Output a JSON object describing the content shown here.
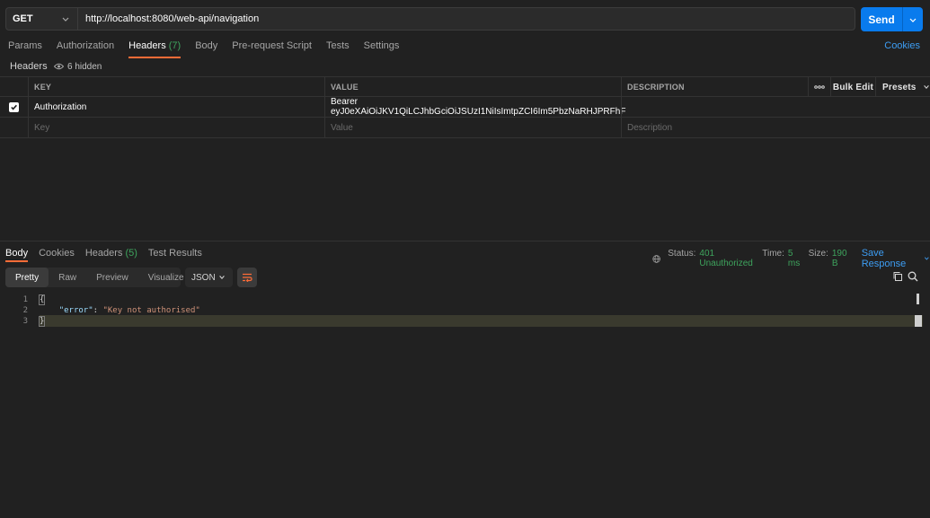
{
  "request": {
    "method": "GET",
    "url": "http://localhost:8080/web-api/navigation",
    "send_label": "Send"
  },
  "request_tabs": [
    {
      "label": "Params",
      "count": ""
    },
    {
      "label": "Authorization",
      "count": ""
    },
    {
      "label": "Headers",
      "count": "(7)"
    },
    {
      "label": "Body",
      "count": ""
    },
    {
      "label": "Pre-request Script",
      "count": ""
    },
    {
      "label": "Tests",
      "count": ""
    },
    {
      "label": "Settings",
      "count": ""
    }
  ],
  "cookies_label": "Cookies",
  "headers_section": {
    "title": "Headers",
    "hidden_label": "6 hidden",
    "columns": {
      "key": "KEY",
      "value": "VALUE",
      "description": "DESCRIPTION",
      "bulk_edit": "Bulk Edit",
      "presets": "Presets"
    },
    "rows": [
      {
        "key": "Authorization",
        "value": "Bearer eyJ0eXAiOiJKV1QiLCJhbGciOiJSUzI1NiIsImtpZCI6Im5PbzNaRHJPRFhF",
        "description": "",
        "checked": true
      }
    ],
    "placeholders": {
      "key": "Key",
      "value": "Value",
      "description": "Description"
    }
  },
  "response_tabs": [
    {
      "label": "Body",
      "count": ""
    },
    {
      "label": "Cookies",
      "count": ""
    },
    {
      "label": "Headers",
      "count": "(5)"
    },
    {
      "label": "Test Results",
      "count": ""
    }
  ],
  "response_status": {
    "status_label": "Status:",
    "status_value": "401 Unauthorized",
    "time_label": "Time:",
    "time_value": "5 ms",
    "size_label": "Size:",
    "size_value": "190 B",
    "save_label": "Save Response"
  },
  "body_formats": [
    "Pretty",
    "Raw",
    "Preview",
    "Visualize"
  ],
  "language": "JSON",
  "code": {
    "line_numbers": [
      "1",
      "2",
      "3"
    ],
    "open": "{",
    "key": "\"error\"",
    "colon": ": ",
    "value": "\"Key not authorised\"",
    "close": "}"
  },
  "colors": {
    "accent_blue": "#097bed",
    "tab_underline": "#ff6c37",
    "status_green": "#3ea45d",
    "link_blue": "#3d9df3"
  }
}
